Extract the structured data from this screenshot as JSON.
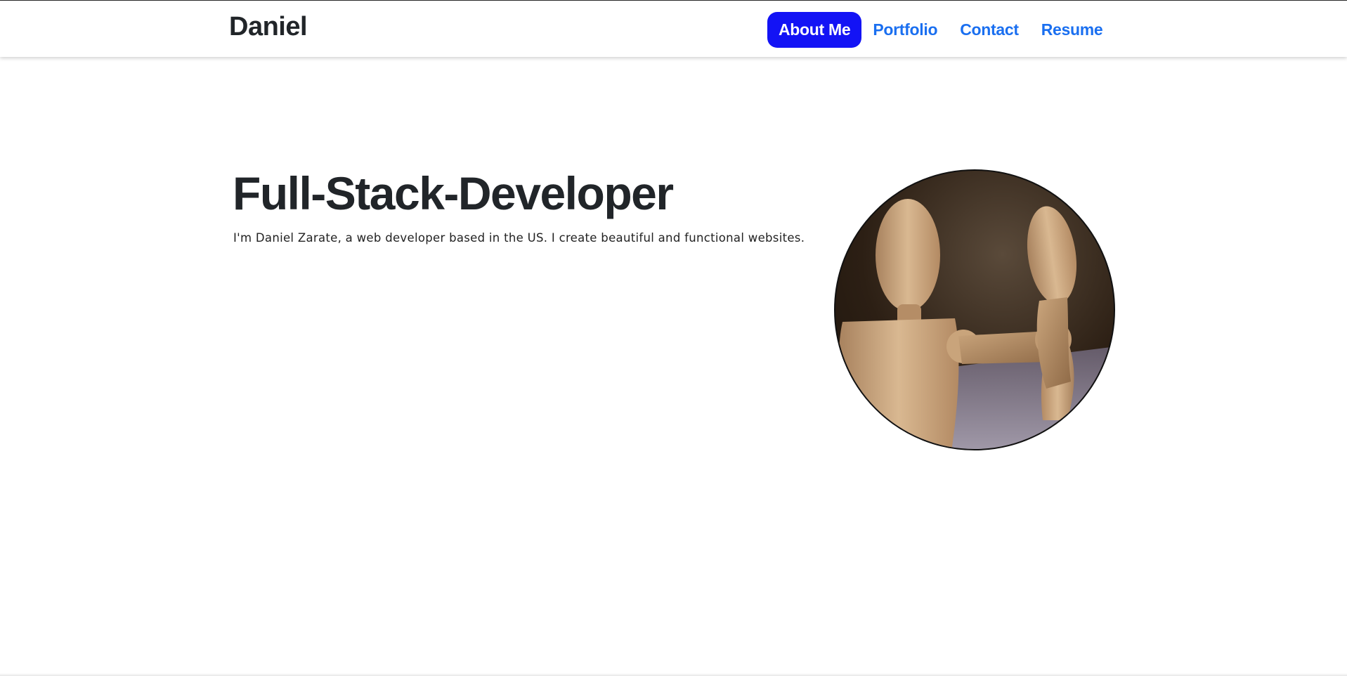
{
  "navbar": {
    "brand": "Daniel",
    "links": [
      {
        "label": "About Me",
        "active": true
      },
      {
        "label": "Portfolio",
        "active": false
      },
      {
        "label": "Contact",
        "active": false
      },
      {
        "label": "Resume",
        "active": false
      }
    ]
  },
  "hero": {
    "title": "Full-Stack-Developer",
    "subtitle": "I'm Daniel Zarate, a web developer based in the US. I create beautiful and functional websites."
  },
  "colors": {
    "active_nav_bg": "#1313f5",
    "nav_link": "#1a6ff0",
    "text_dark": "#212529"
  },
  "icons": {
    "avatar": "wooden-mannequin-photo"
  }
}
